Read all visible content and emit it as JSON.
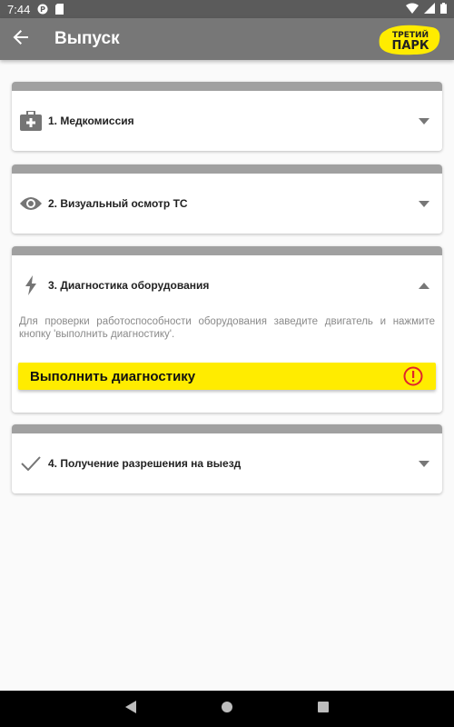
{
  "status_bar": {
    "time": "7:44",
    "icons": [
      "app-notification-icon",
      "sd-card-icon",
      "wifi-icon",
      "signal-icon",
      "battery-icon"
    ]
  },
  "app_bar": {
    "title": "Выпуск",
    "back_icon": "arrow-left-icon",
    "logo_line1": "ТРЕТИЙ",
    "logo_line2": "ПАРК"
  },
  "sections": [
    {
      "label": "1. Медкомиссия",
      "icon": "medical-kit-icon",
      "expanded": false
    },
    {
      "label": "2. Визуальный осмотр ТС",
      "icon": "eye-icon",
      "expanded": false
    },
    {
      "label": "3. Диагностика оборудования",
      "icon": "lightning-icon",
      "expanded": true,
      "description": "Для проверки работоспособности оборудования заведите двигатель и нажмите кнопку 'выполнить диагностику'.",
      "button_label": "Выполнить диагностику",
      "button_status_icon": "warning-circle-icon"
    },
    {
      "label": "4. Получение разрешения на выезд",
      "icon": "check-icon",
      "expanded": false
    }
  ],
  "colors": {
    "accent_yellow": "#ffec00",
    "warning_red": "#e0252b",
    "app_bar": "#777777",
    "status_bar": "#5b5b5b"
  },
  "nav_bar": [
    "back-triangle-icon",
    "home-circle-icon",
    "recents-square-icon"
  ]
}
